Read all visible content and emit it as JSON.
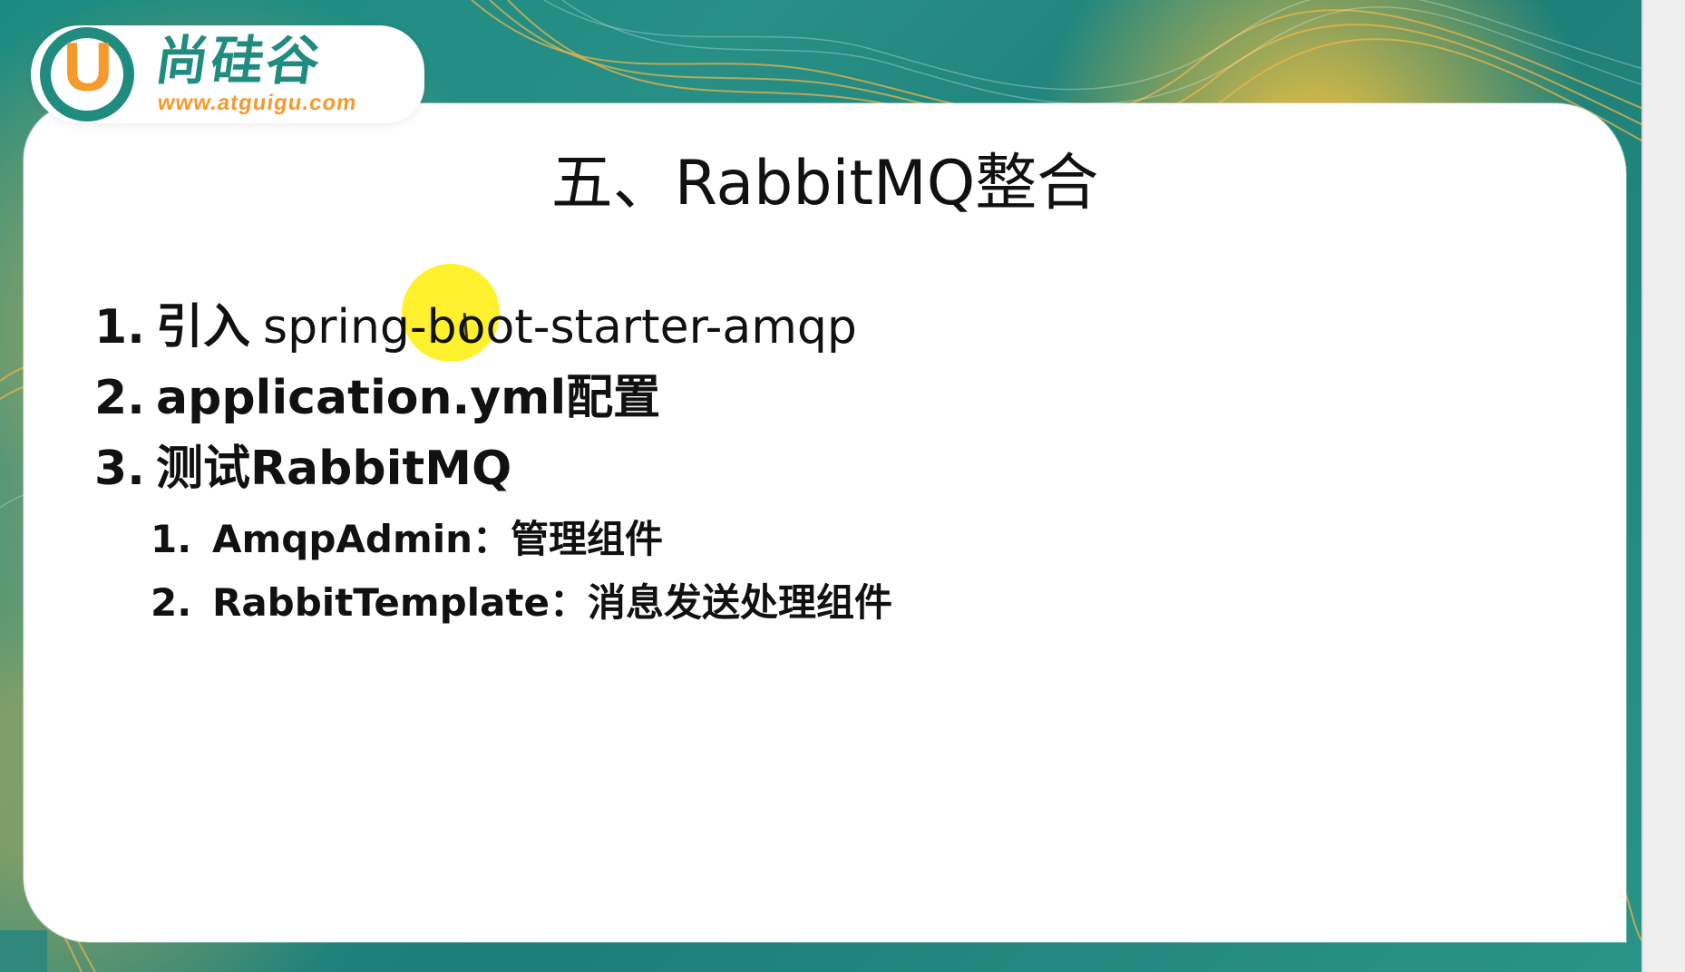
{
  "brand": {
    "logo_letter": "U",
    "name": "尚硅谷",
    "url": "www.atguigu.com"
  },
  "slide": {
    "title": "五、RabbitMQ整合",
    "items": [
      {
        "number": "1.",
        "label": "引入",
        "value": "spring-boot-starter-amqp"
      },
      {
        "number": "2.",
        "text": "application.yml配置"
      },
      {
        "number": "3.",
        "text": "测试RabbitMQ"
      }
    ],
    "subitems": [
      {
        "number": "1.",
        "text": "AmqpAdmin：管理组件"
      },
      {
        "number": "2.",
        "text": "RabbitTemplate：消息发送处理组件"
      }
    ]
  },
  "theme": {
    "teal": "#1f8c7f",
    "orange": "#f59a2d",
    "highlight": "#ffee00"
  }
}
